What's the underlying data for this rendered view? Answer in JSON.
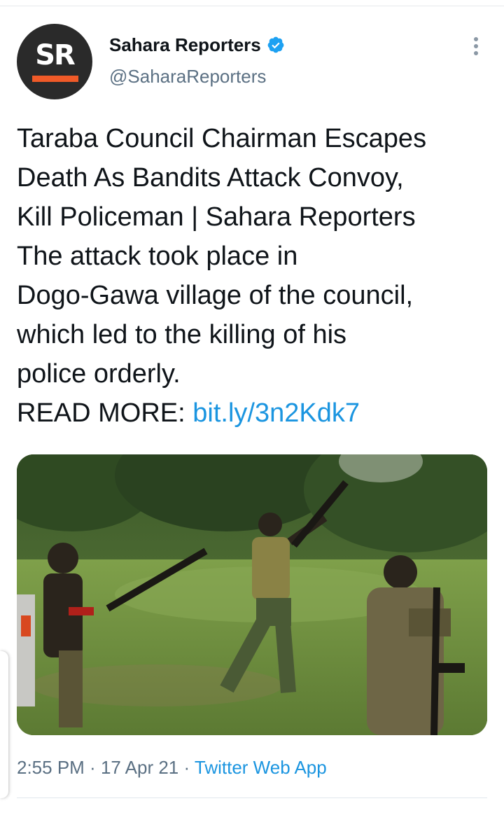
{
  "author": {
    "display_name": "Sahara Reporters",
    "handle": "@SaharaReporters",
    "avatar_text": "SR",
    "verified": true,
    "avatar_bg": "#2a2a2a",
    "avatar_accent": "#f05a28"
  },
  "tweet": {
    "lines": [
      "Taraba Council Chairman Escapes",
      "Death As Bandits Attack Convoy,",
      "Kill Policeman | Sahara Reporters",
      "The attack took place in",
      "Dogo-Gawa village of the council,",
      "which led to the killing of his",
      "police orderly."
    ],
    "read_more_label": "READ MORE: ",
    "link_text": "bit.ly/3n2Kdk7"
  },
  "media": {
    "type": "photo"
  },
  "meta": {
    "time": "2:55 PM",
    "separator": " · ",
    "date": "17 Apr 21",
    "source": "Twitter Web App"
  },
  "icons": {
    "verified": "verified-badge-icon",
    "more": "more-vertical-icon"
  },
  "colors": {
    "link": "#1b95e0",
    "secondary_text": "#5b7083",
    "primary_text": "#0f1419",
    "verified": "#1da1f2"
  }
}
